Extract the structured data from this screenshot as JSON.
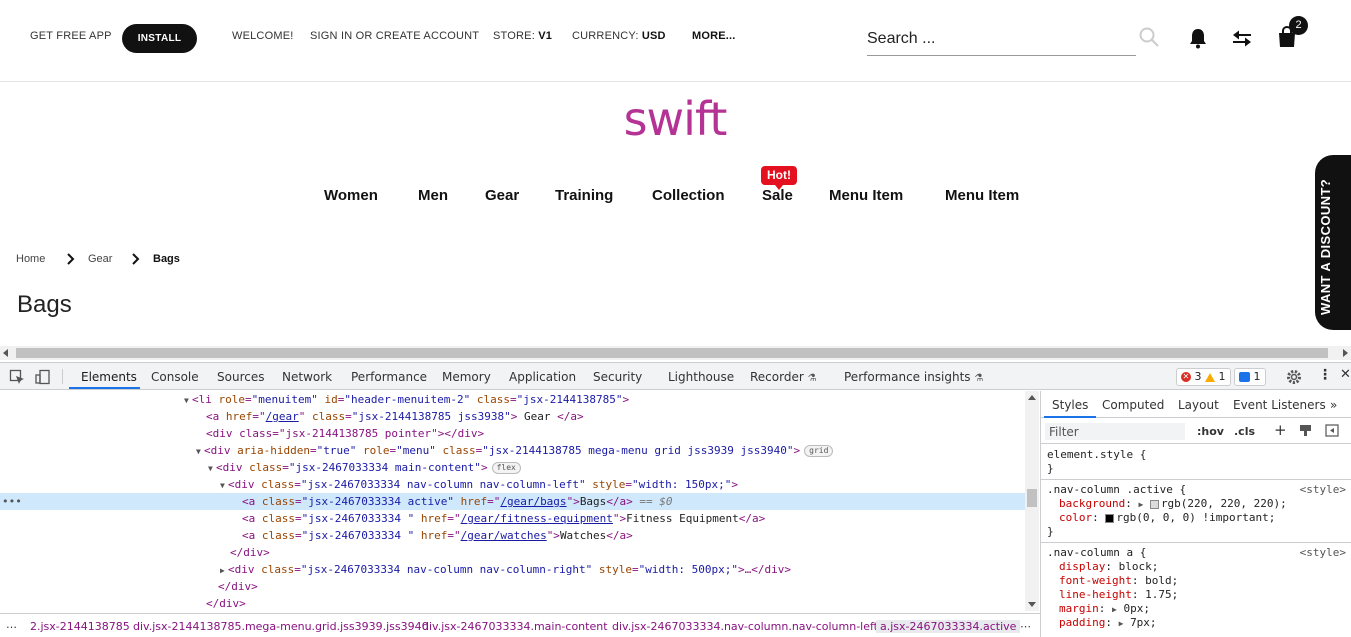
{
  "topbar": {
    "get_app": "GET FREE APP",
    "install": "INSTALL",
    "welcome": "WELCOME!",
    "signin": "SIGN IN OR CREATE ACCOUNT",
    "store_label": "STORE:",
    "store_value": "V1",
    "currency_label": "CURRENCY:",
    "currency_value": "USD",
    "more": "MORE...",
    "search_placeholder": "Search ...",
    "cart_count": "2"
  },
  "logo": "swift",
  "nav": {
    "items": [
      "Women",
      "Men",
      "Gear",
      "Training",
      "Collection",
      "Sale",
      "Menu Item",
      "Menu Item"
    ],
    "hot_badge": "Hot!"
  },
  "breadcrumb": [
    "Home",
    "Gear",
    "Bags"
  ],
  "page_title": "Bags",
  "discount_tab": "WANT A DISCOUNT?",
  "devtools": {
    "tabs": [
      "Elements",
      "Console",
      "Sources",
      "Network",
      "Performance",
      "Memory",
      "Application",
      "Security",
      "Lighthouse",
      "Recorder",
      "Performance insights"
    ],
    "errors": "3",
    "warnings": "1",
    "messages": "1",
    "dom_lines": {
      "l1_tag": "<li ",
      "l1_a1": "role",
      "l1_v1": "\"menuitem\"",
      "l1_a2": "id",
      "l1_v2": "\"header-menuitem-2\"",
      "l1_a3": "class",
      "l1_v3": "\"jsx-2144138785\"",
      "l1_end": ">",
      "l2_tag": "<a ",
      "l2_a1": "href",
      "l2_link": "/gear",
      "l2_a2": "class",
      "l2_v2": "\"jsx-2144138785 jss3938\"",
      "l2_text": " Gear ",
      "l2_end": "</a>",
      "l3": "<div class=\"jsx-2144138785 pointer\"></div>",
      "l4_tag": "<div ",
      "l4_a1": "aria-hidden",
      "l4_v1": "\"true\"",
      "l4_a2": "role",
      "l4_v2": "\"menu\"",
      "l4_a3": "class",
      "l4_v3": "\"jsx-2144138785 mega-menu grid jss3939 jss3940\"",
      "l4_end": ">",
      "l4_pill": "grid",
      "l5_tag": "<div ",
      "l5_a1": "class",
      "l5_v1": "\"jsx-2467033334 main-content\"",
      "l5_end": ">",
      "l5_pill": "flex",
      "l6_tag": "<div ",
      "l6_a1": "class",
      "l6_v1": "\"jsx-2467033334 nav-column nav-column-left\"",
      "l6_a2": "style",
      "l6_v2": "\"width: 150px;\"",
      "l6_end": ">",
      "l7_tag": "<a ",
      "l7_a1": "class",
      "l7_v1": "\"jsx-2467033334 active\"",
      "l7_a2": "href",
      "l7_link": "/gear/bags",
      "l7_text": "Bags",
      "l7_end": "</a>",
      "l7_eq": " == $0",
      "l8_tag": "<a ",
      "l8_a1": "class",
      "l8_v1": "\"jsx-2467033334 \"",
      "l8_a2": "href",
      "l8_link": "/gear/fitness-equipment",
      "l8_text": "Fitness Equipment",
      "l8_end": "</a>",
      "l9_tag": "<a ",
      "l9_a1": "class",
      "l9_v1": "\"jsx-2467033334 \"",
      "l9_a2": "href",
      "l9_link": "/gear/watches",
      "l9_text": "Watches",
      "l9_end": "</a>",
      "l10": "</div>",
      "l11_tag": "<div ",
      "l11_a1": "class",
      "l11_v1": "\"jsx-2467033334 nav-column nav-column-right\"",
      "l11_a2": "style",
      "l11_v2": "\"width: 500px;\"",
      "l11_end": ">…</div>",
      "l12": "</div>",
      "l13": "</div>"
    },
    "crumbs": [
      "2.jsx-2144138785",
      "div.jsx-2144138785.mega-menu.grid.jss3939.jss3940",
      "div.jsx-2467033334.main-content",
      "div.jsx-2467033334.nav-column.nav-column-left",
      "a.jsx-2467033334.active"
    ],
    "styles_tabs": [
      "Styles",
      "Computed",
      "Layout",
      "Event Listeners"
    ],
    "filter_placeholder": "Filter",
    "hov": ":hov",
    "cls": ".cls",
    "rules": {
      "element_style": "element.style {",
      "close": "}",
      "r1_selector": ".nav-column .active {",
      "r1_origin": "<style>",
      "r1_p1": "background",
      "r1_v1": "rgb(220, 220, 220);",
      "r1_p2": "color",
      "r1_v2": "rgb(0, 0, 0) !important;",
      "r2_selector": ".nav-column a {",
      "r2_origin": "<style>",
      "r2_p1": "display",
      "r2_v1": "block;",
      "r2_p2": "font-weight",
      "r2_v2": "bold;",
      "r2_p3": "line-height",
      "r2_v3": "1.75;",
      "r2_p4": "margin",
      "r2_v4": "0px;",
      "r2_p5": "padding",
      "r2_v5": "7px;"
    }
  }
}
